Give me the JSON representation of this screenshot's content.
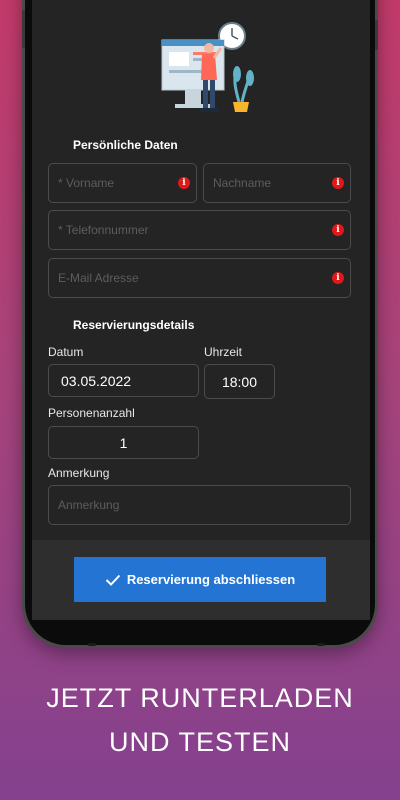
{
  "personal": {
    "title": "Persönliche Daten",
    "firstname_placeholder": "* Vorname",
    "lastname_placeholder": "Nachname",
    "phone_placeholder": "* Telefonnummer",
    "email_placeholder": "E-Mail Adresse"
  },
  "reservation": {
    "title": "Reservierungsdetails",
    "date_label": "Datum",
    "date_value": "03.05.2022",
    "time_label": "Uhrzeit",
    "time_value": "18:00",
    "persons_label": "Personenanzahl",
    "persons_value": "1",
    "note_label": "Anmerkung",
    "note_placeholder": "Anmerkung"
  },
  "submit_label": "Reservierung abschliessen",
  "tagline": {
    "line1": "JETZT RUNTERLADEN",
    "line2": "UND TESTEN"
  },
  "colors": {
    "accent": "#2374d3",
    "info": "#e01818",
    "screen_bg": "#242424"
  },
  "icons": [
    "illustration",
    "info-icon",
    "check-icon"
  ]
}
